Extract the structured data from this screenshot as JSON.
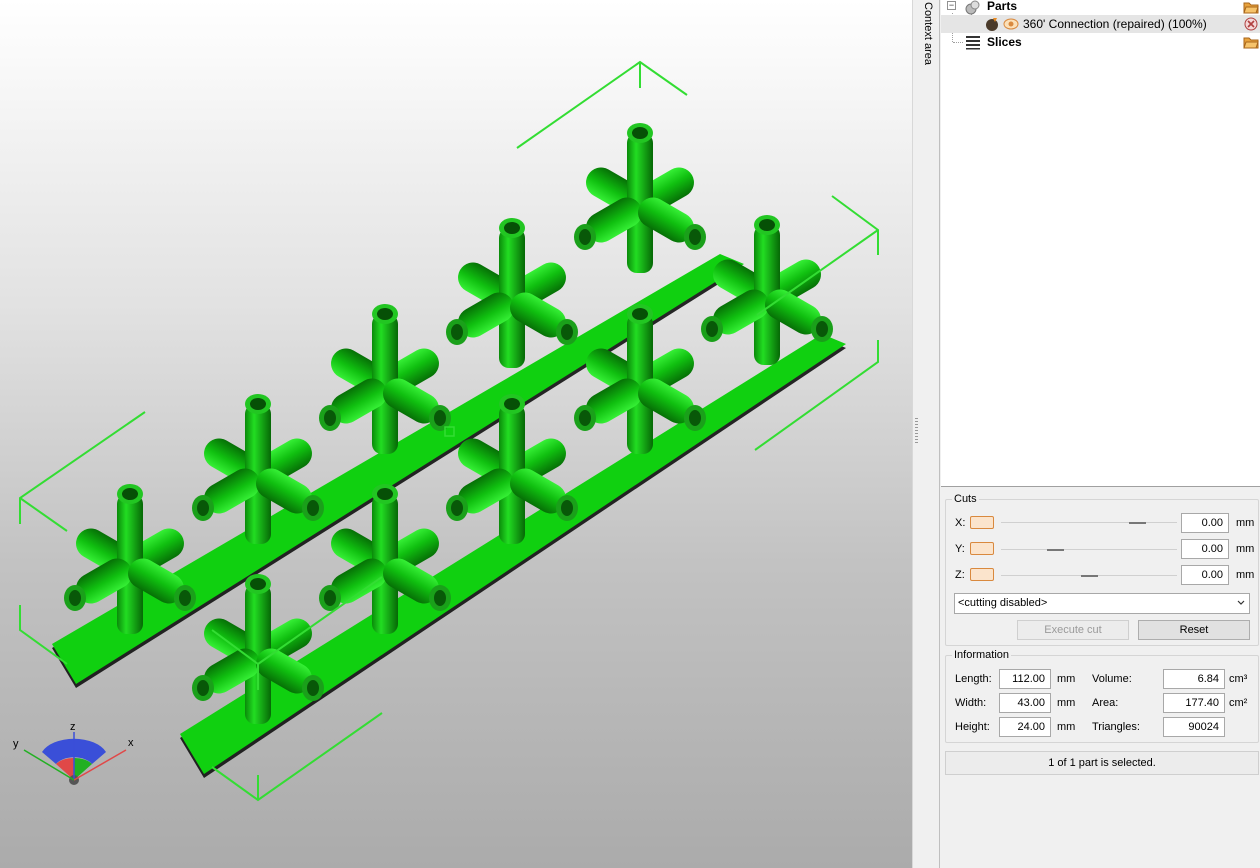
{
  "context_tab": {
    "label": "Context area"
  },
  "tree": {
    "parts": {
      "label": "Parts",
      "expander": "−",
      "icon": "parts-icon",
      "folder_icon": "folder-open-icon"
    },
    "part_item": {
      "label": "360' Connection (repaired) (100%)",
      "icon": "model-icon",
      "visibility_icon": "eye-icon",
      "remove_icon": "remove-icon"
    },
    "slices": {
      "label": "Slices",
      "icon": "slices-icon",
      "folder_icon": "folder-open-icon"
    }
  },
  "cuts": {
    "title": "Cuts",
    "rows": [
      {
        "axis": "X:",
        "value": "0.00",
        "unit": "mm",
        "slider_pos": 0.75
      },
      {
        "axis": "Y:",
        "value": "0.00",
        "unit": "mm",
        "slider_pos": 0.29
      },
      {
        "axis": "Z:",
        "value": "0.00",
        "unit": "mm",
        "slider_pos": 0.5
      }
    ],
    "mode": "<cutting disabled>",
    "execute_label": "Execute cut",
    "reset_label": "Reset"
  },
  "information": {
    "title": "Information",
    "length": {
      "label": "Length:",
      "value": "112.00",
      "unit": "mm"
    },
    "width": {
      "label": "Width:",
      "value": "43.00",
      "unit": "mm"
    },
    "height": {
      "label": "Height:",
      "value": "24.00",
      "unit": "mm"
    },
    "volume": {
      "label": "Volume:",
      "value": "6.84",
      "unit": "cm³"
    },
    "area": {
      "label": "Area:",
      "value": "177.40",
      "unit": "cm²"
    },
    "triangles": {
      "label": "Triangles:",
      "value": "90024"
    }
  },
  "status": "1 of 1 part is selected.",
  "axes": {
    "x": "x",
    "y": "y",
    "z": "z"
  },
  "colors": {
    "model": "#10d010",
    "bounding_box": "#33dd33",
    "accent": "#d9893e"
  }
}
